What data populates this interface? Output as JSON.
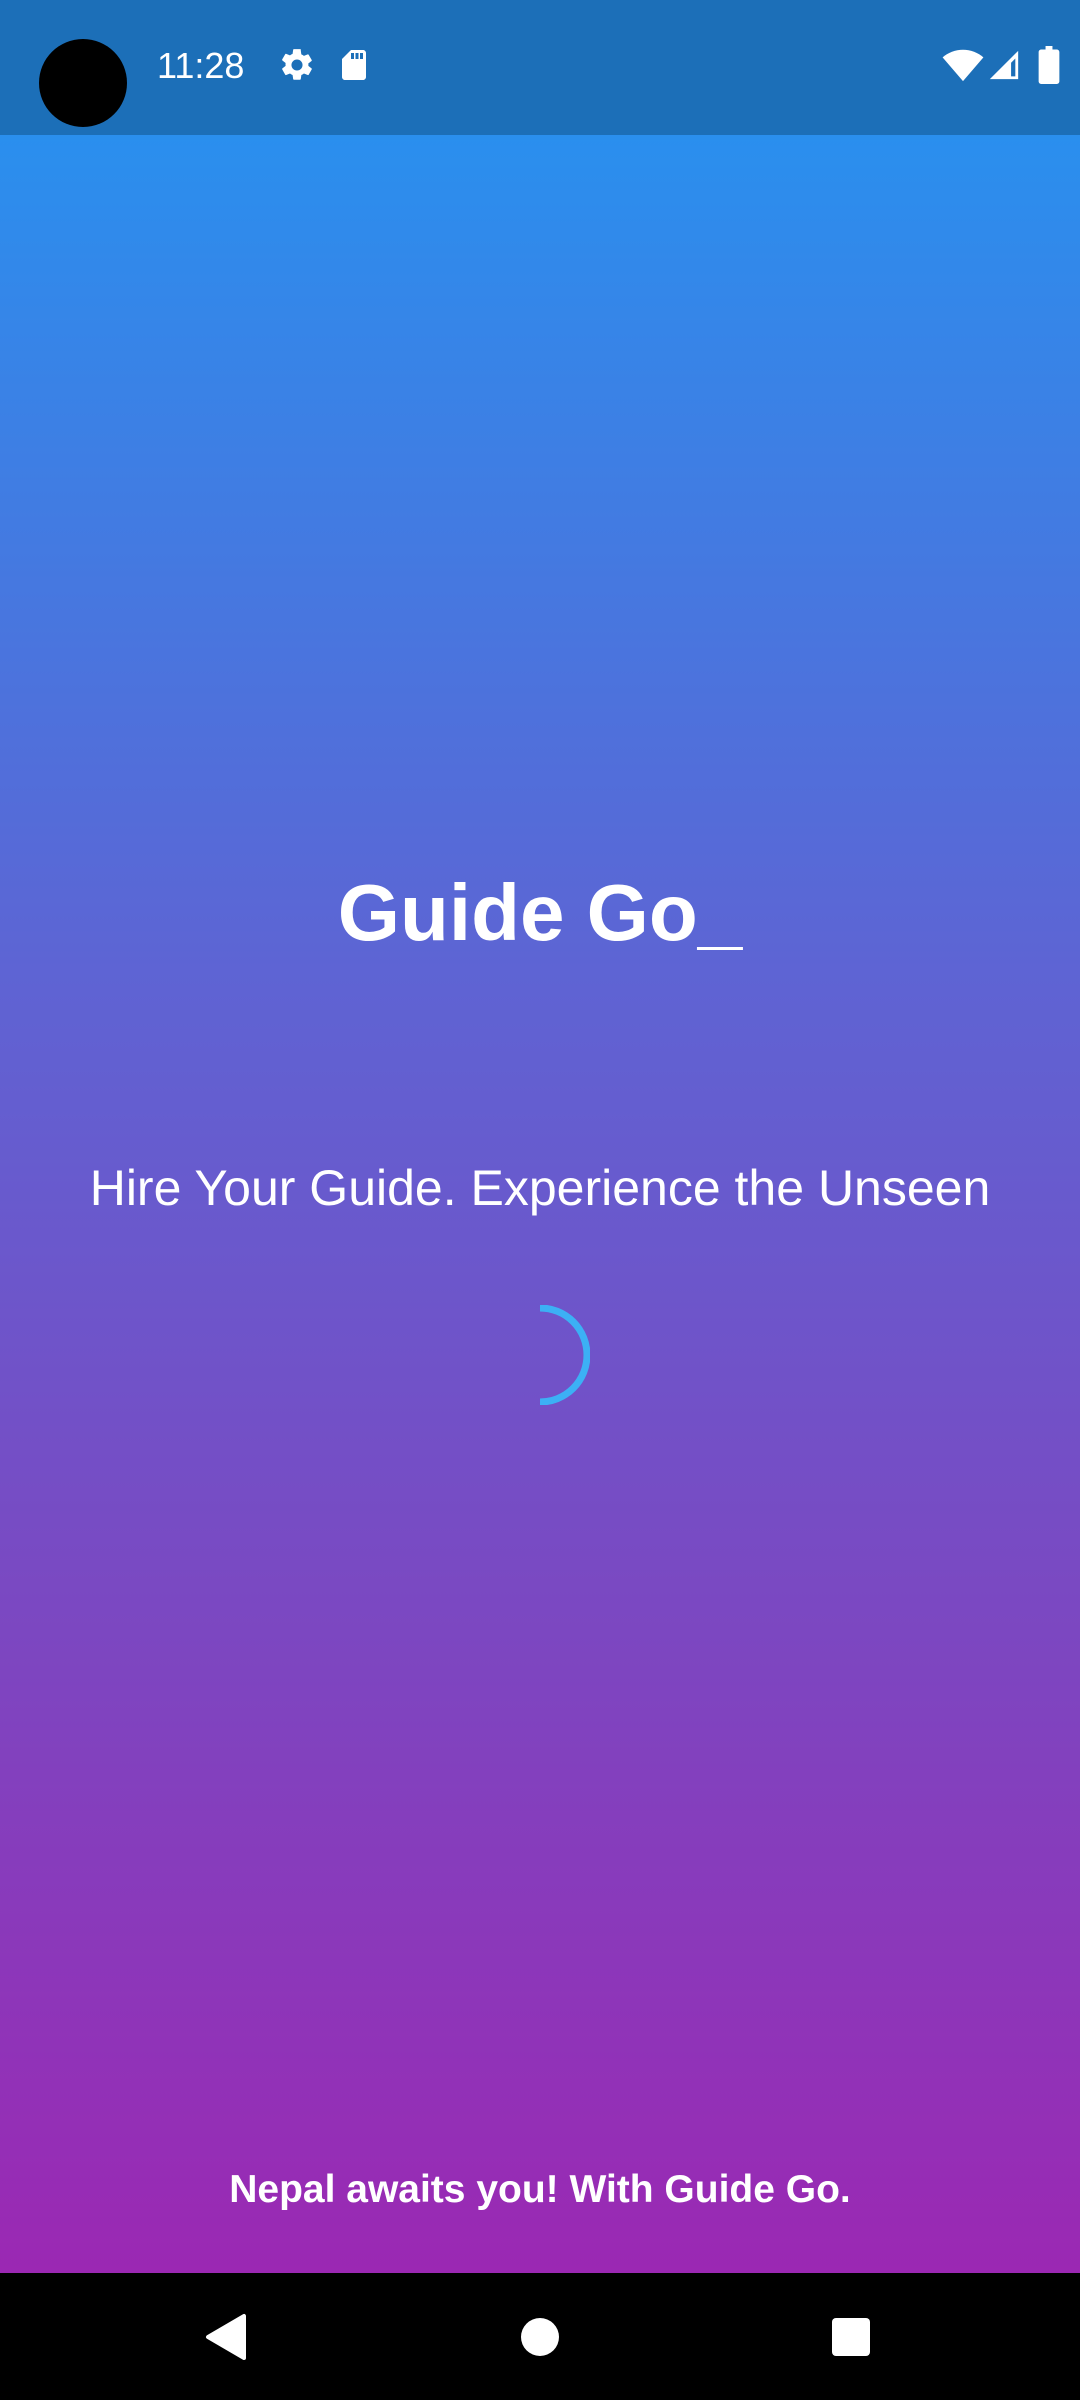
{
  "status_bar": {
    "time": "11:28",
    "icons": [
      "settings-icon",
      "sd-card-icon",
      "wifi-icon",
      "cellular-signal-icon",
      "battery-icon"
    ]
  },
  "app": {
    "title": "Guide Go_",
    "tagline": "Hire Your Guide. Experience the Unseen",
    "footer": "Nepal awaits you! With Guide Go.",
    "colors": {
      "gradient_top": "#2a8fee",
      "gradient_bottom": "#9b28b3",
      "spinner": "#3cb0f5"
    }
  },
  "nav_bar": {
    "buttons": [
      "back-icon",
      "home-icon",
      "recents-icon"
    ]
  }
}
